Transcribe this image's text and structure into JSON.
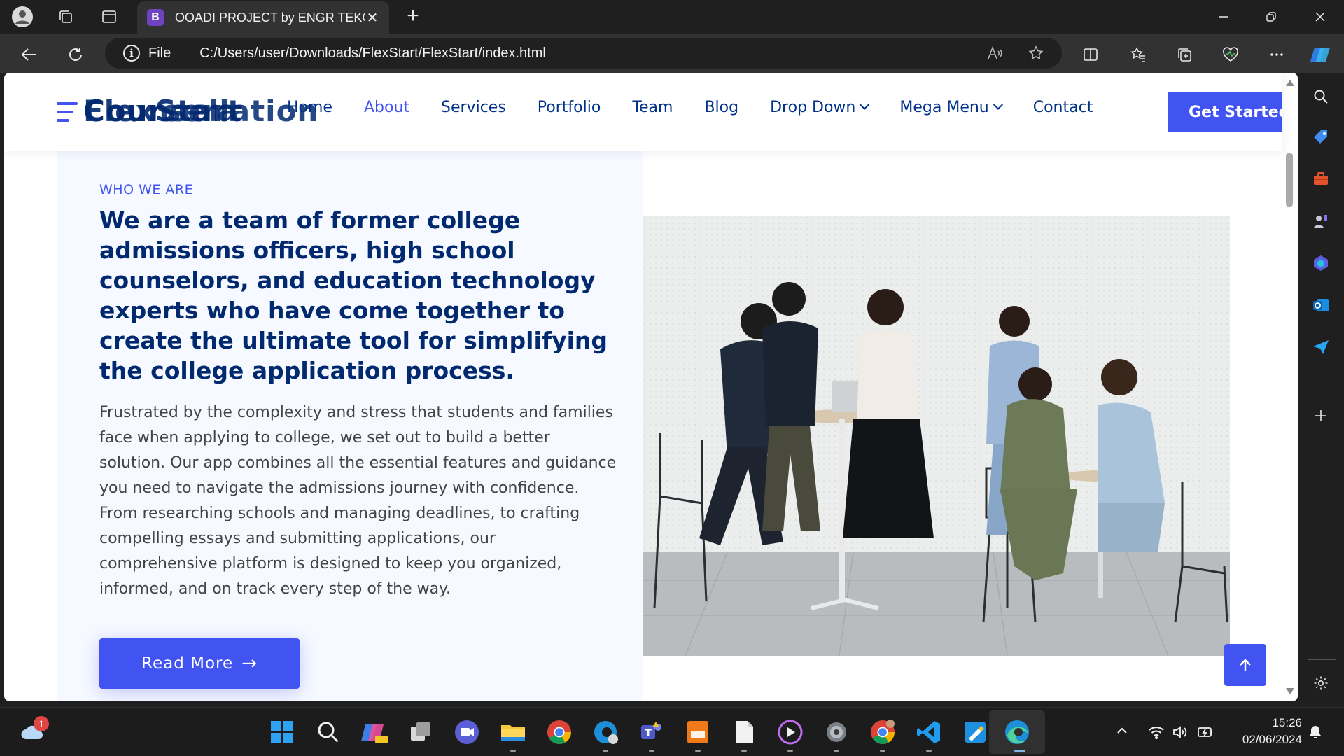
{
  "browser": {
    "tab_favicon_letter": "B",
    "tab_title": "OOADI PROJECT by ENGR TEKO",
    "new_tab_symbol": "+",
    "url_scheme_label": "File",
    "url": "C:/Users/user/Downloads/FlexStart/FlexStart/index.html"
  },
  "site": {
    "logo_text_layers": [
      "FlexStart",
      "Counsellation",
      "Coursera"
    ],
    "nav_items": [
      "Home",
      "About",
      "Services",
      "Portfolio",
      "Team",
      "Blog",
      "Drop Down",
      "Mega Menu",
      "Contact"
    ],
    "active_nav": "About",
    "cta_label": "Get Started",
    "brand_color": "#4154f1",
    "heading_color": "#012970"
  },
  "about": {
    "eyebrow": "WHO WE ARE",
    "title": "We are a team of former college admissions officers, high school counselors, and education technology experts who have come together to create the ultimate tool for simplifying the college application process.",
    "body": "Frustrated by the complexity and stress that students and families face when applying to college, we set out to build a better solution. Our app combines all the essential features and guidance you need to navigate the admissions journey with confidence. From researching schools and managing deadlines, to crafting compelling essays and submitting applications, our comprehensive platform is designed to keep you organized, informed, and on track every step of the way.",
    "read_more_label": "Read More",
    "read_more_arrow": "→"
  },
  "taskbar": {
    "weather_badge": "1",
    "time": "15:26",
    "date": "02/06/2024"
  }
}
